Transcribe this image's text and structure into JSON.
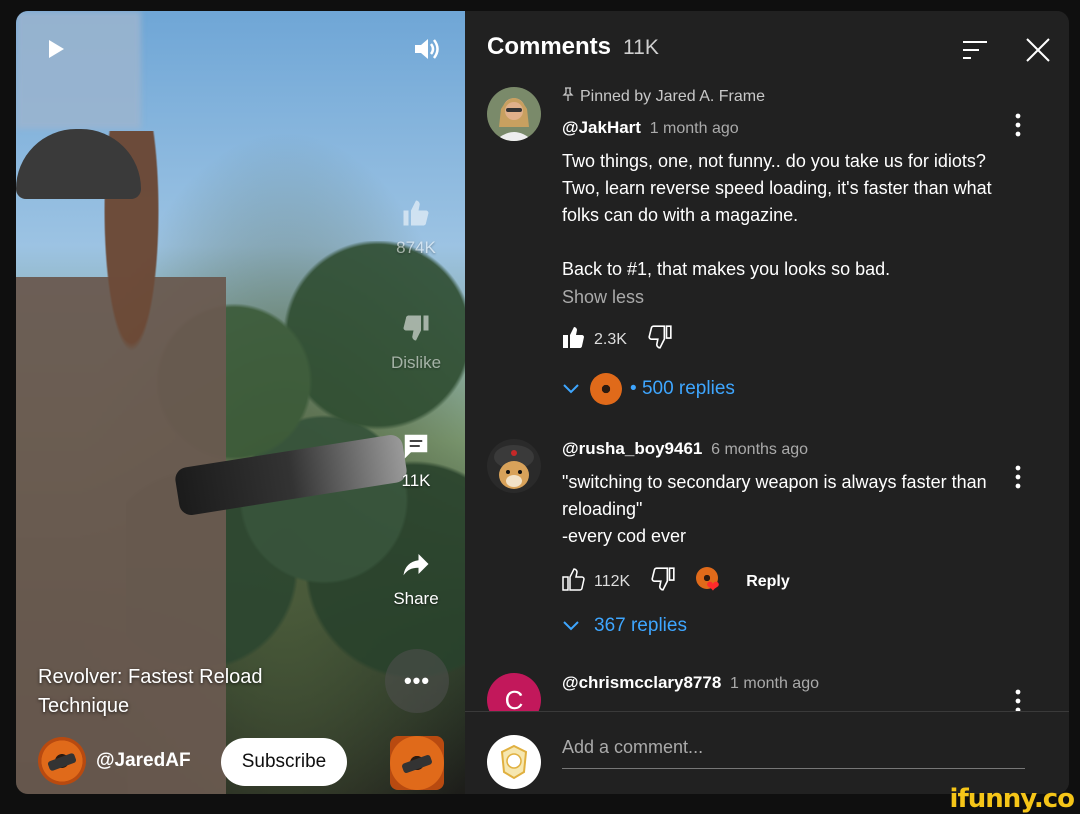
{
  "video": {
    "like_count": "874K",
    "dislike_label": "Dislike",
    "comment_count": "11K",
    "share_label": "Share",
    "more_label": "•••",
    "title": "Revolver: Fastest Reload Technique",
    "channel_handle": "@JaredAF",
    "subscribe_label": "Subscribe"
  },
  "comments_panel": {
    "title": "Comments",
    "count": "11K",
    "add_placeholder": "Add a comment...",
    "comments": [
      {
        "pinned": "Pinned by Jared A. Frame",
        "author": "@JakHart",
        "time": "1 month ago",
        "text": "Two things, one, not funny.. do you take us for idiots? Two, learn reverse speed loading, it's faster than what folks can do with a magazine.\n\nBack to #1, that makes you looks so bad.",
        "show_less": "Show less",
        "likes": "2.3K",
        "replies": "500 replies"
      },
      {
        "author": "@rusha_boy9461",
        "time": "6 months ago",
        "text": "\"switching to secondary weapon is always faster than reloading\"\n-every cod ever",
        "likes": "112K",
        "reply_label": "Reply",
        "replies": "367 replies"
      },
      {
        "author": "@chrismcclary8778",
        "time": "1 month ago",
        "avatar_letter": "C"
      }
    ]
  },
  "watermark": "ifunny.co",
  "colors": {
    "accent_link": "#3ea6ff",
    "panel_bg": "#212121",
    "page_bg": "#0f0f0f"
  }
}
